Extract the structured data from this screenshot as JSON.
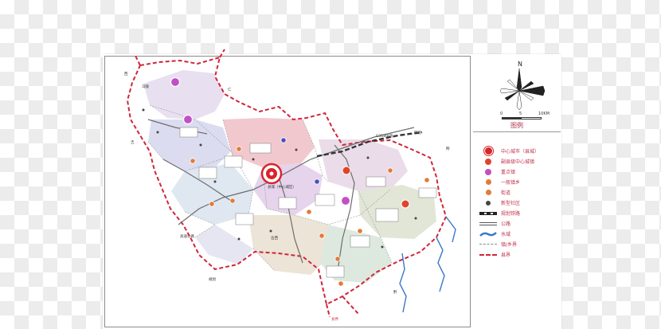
{
  "legend": {
    "title": "图例",
    "items": [
      {
        "key": "center_city",
        "label": "中心城市（县城）",
        "color": "#d8242b",
        "icon": "red-bullseye"
      },
      {
        "key": "sub_center",
        "label": "副县级中心城镇",
        "color": "#e0452b",
        "icon": "red-dot"
      },
      {
        "key": "key_town",
        "label": "重点镇",
        "color": "#c14fc5",
        "icon": "purple-dot"
      },
      {
        "key": "general_town",
        "label": "一般镇乡",
        "color": "#e37a3a",
        "icon": "orange-dot"
      },
      {
        "key": "street",
        "label": "街道",
        "color": "#4a4fbe",
        "icon": "blue-dot"
      },
      {
        "key": "new_community",
        "label": "新型社区",
        "color": "#444444",
        "icon": "dark-dot"
      },
      {
        "key": "planned_railway",
        "label": "规划铁路",
        "icon": "railway-line"
      },
      {
        "key": "highway",
        "label": "公路",
        "icon": "road-line"
      },
      {
        "key": "water",
        "label": "水域",
        "color": "#3a78c8",
        "icon": "water-line"
      },
      {
        "key": "town_boundary",
        "label": "镇/乡界",
        "icon": "dashed-gray-line"
      },
      {
        "key": "county_boundary",
        "label": "县界",
        "color": "#d0263a",
        "icon": "dashed-red-line"
      }
    ]
  },
  "compass": {
    "north_label": "N"
  },
  "scale": {
    "ticks": [
      "0",
      "5",
      "10KM"
    ]
  },
  "map": {
    "main_city_label": "县城（中心城区）",
    "place_labels": [
      "马陵",
      "西",
      "高速公路",
      "铁路",
      "G318国道",
      "岳西",
      "县界",
      "规划",
      "荆",
      "吉",
      "仁",
      "黔"
    ],
    "colors": {
      "boundary": "#d0263a",
      "river": "#3a78c8",
      "road": "#6d6d6d",
      "town_fill": "#e9e2ef"
    }
  }
}
